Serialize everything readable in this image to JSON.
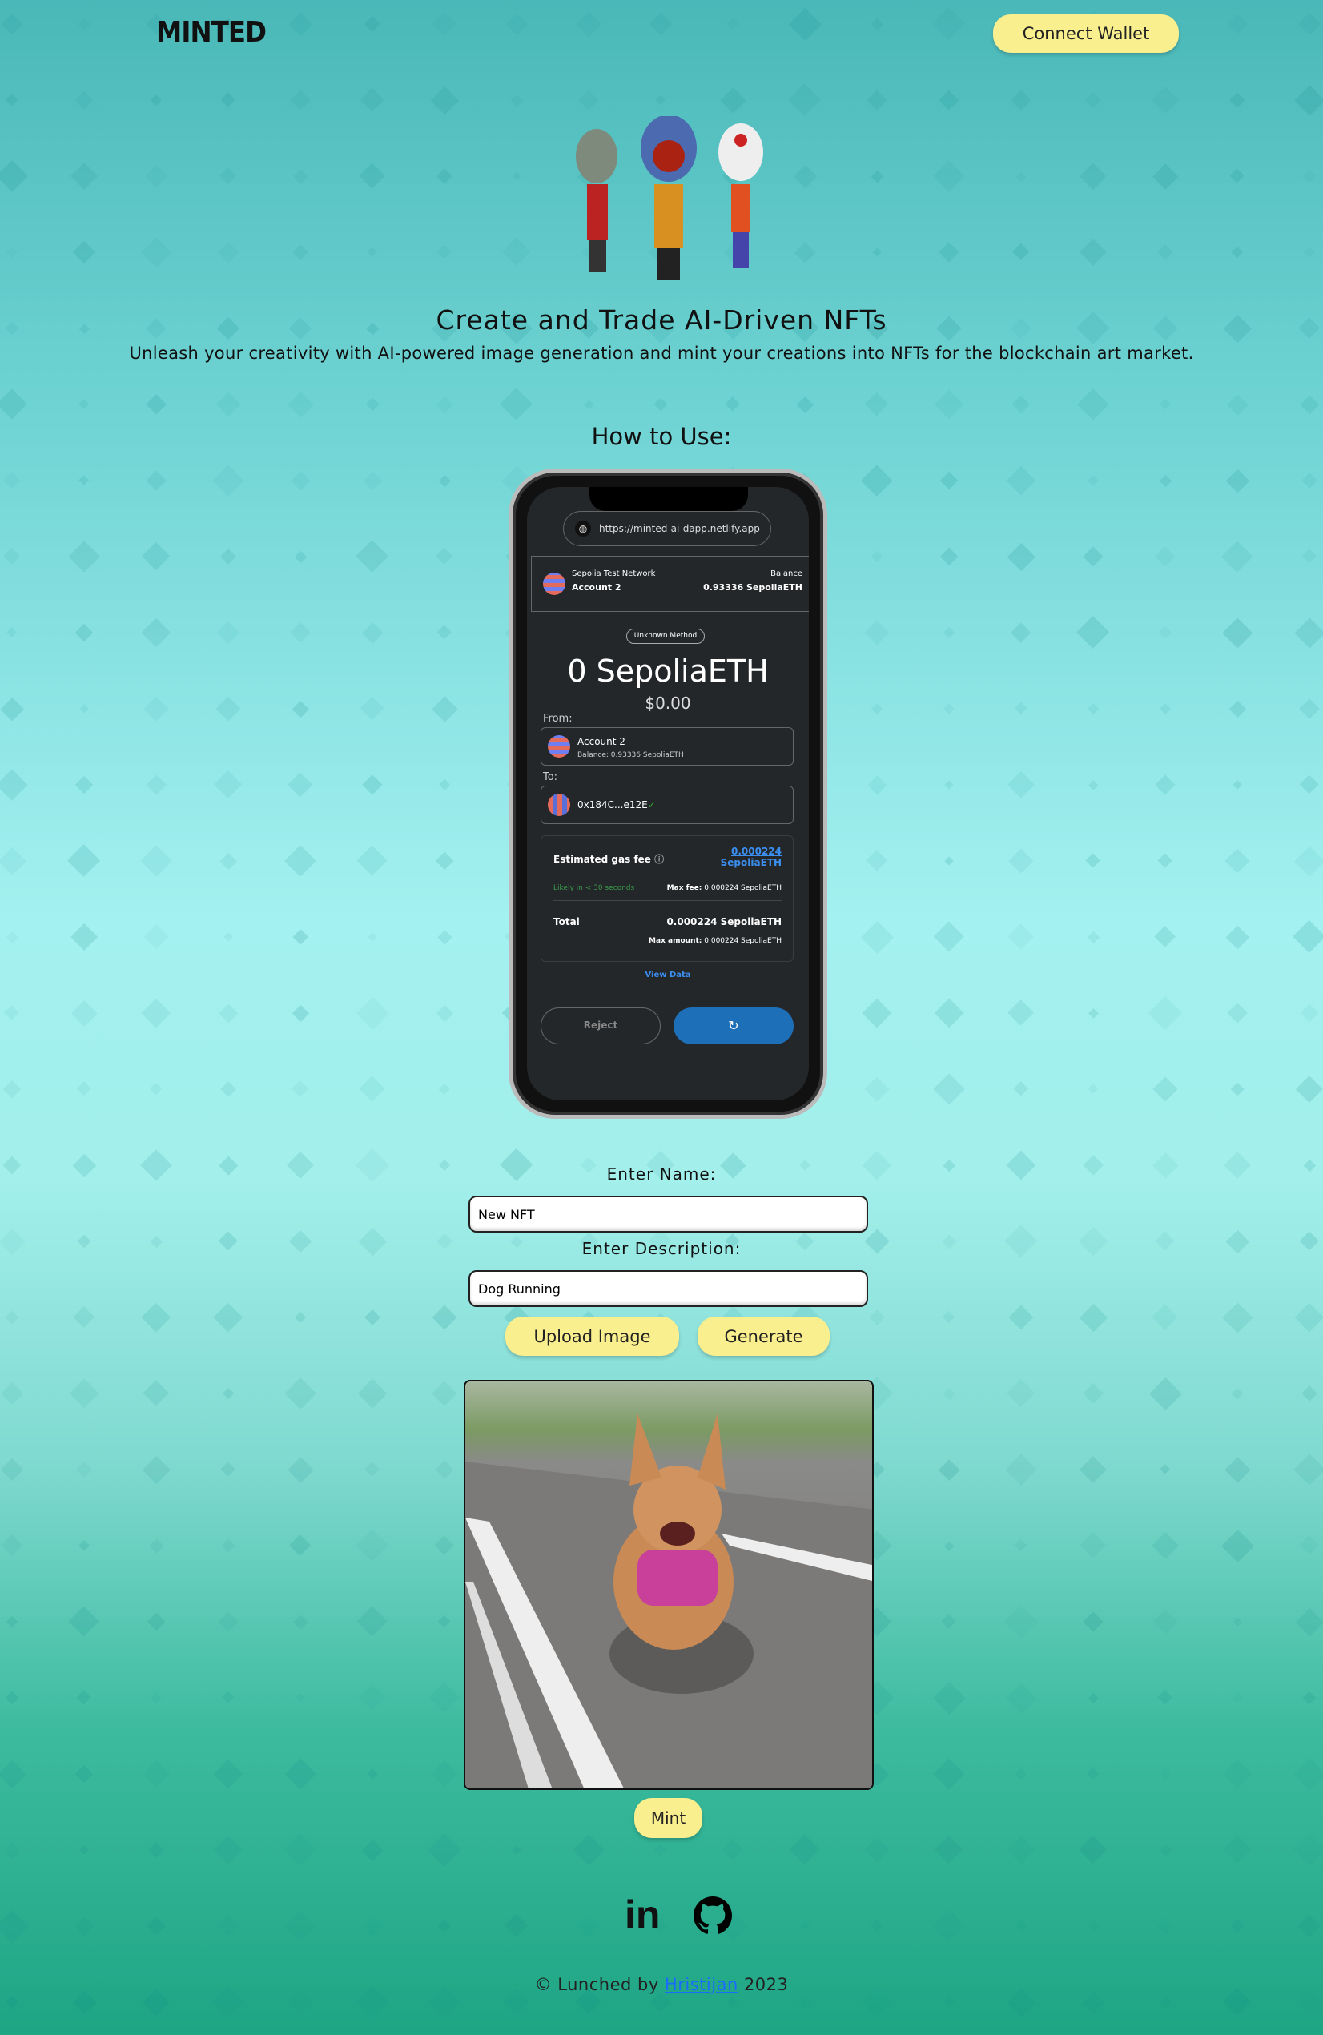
{
  "header": {
    "logo": "MINTED",
    "connect_wallet": "Connect Wallet"
  },
  "hero": {
    "title": "Create and Trade AI-Driven NFTs",
    "subtitle": "Unleash your creativity with AI-powered image generation and mint your creations into NFTs for the blockchain art market.",
    "how_to": "How to Use:"
  },
  "phone": {
    "url": "https://minted-ai-dapp.netlify.app",
    "network": "Sepolia Test Network",
    "account": "Account 2",
    "balance_label": "Balance",
    "balance": "0.93336 SepoliaETH",
    "method": "Unknown Method",
    "amount": "0 SepoliaETH",
    "usd": "$0.00",
    "from_label": "From:",
    "from_account": "Account 2",
    "from_balance": "Balance: 0.93336 SepoliaETH",
    "to_label": "To:",
    "to_address": "0x184C...e12E",
    "gas_label": "Estimated gas fee",
    "gas_value": "0.000224",
    "gas_unit": "SepoliaETH",
    "likely": "Likely in < 30 seconds",
    "max_fee_label": "Max fee:",
    "max_fee": "0.000224 SepoliaETH",
    "total_label": "Total",
    "total": "0.000224 SepoliaETH",
    "max_amount_label": "Max amount:",
    "max_amount": "0.000224 SepoliaETH",
    "view_data": "View Data",
    "reject": "Reject"
  },
  "form": {
    "name_label": "Enter Name:",
    "name_value": "New NFT",
    "desc_label": "Enter Description:",
    "desc_value": "Dog Running",
    "upload": "Upload Image",
    "generate": "Generate",
    "mint": "Mint"
  },
  "footer": {
    "prefix": "© Lunched by",
    "author": "Hristijan",
    "year": "2023",
    "icons": [
      "linkedin-icon",
      "github-icon"
    ]
  },
  "colors": {
    "button": "#f9ef8e",
    "link": "#1a6cff",
    "confirm": "#1d6fb8"
  }
}
